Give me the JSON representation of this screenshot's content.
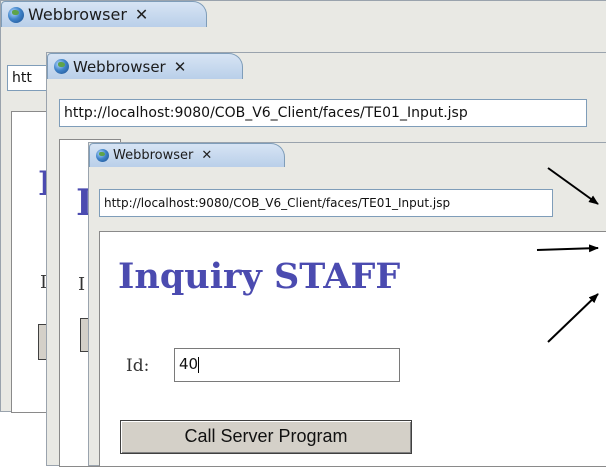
{
  "windows": [
    {
      "tab_title": "Webbrowser",
      "url": "htt",
      "title": "I",
      "id_label": "I"
    },
    {
      "tab_title": "Webbrowser",
      "url": "http://localhost:9080/COB_V6_Client/faces/TE01_Input.jsp",
      "title": "I",
      "id_label": "I"
    },
    {
      "tab_title": "Webbrowser",
      "url": "http://localhost:9080/COB_V6_Client/faces/TE01_Input.jsp",
      "title": "Inquiry STAFF",
      "id_label": "Id:",
      "id_value": "40",
      "button_label": "Call Server Program"
    }
  ],
  "close_glyph": "✕"
}
